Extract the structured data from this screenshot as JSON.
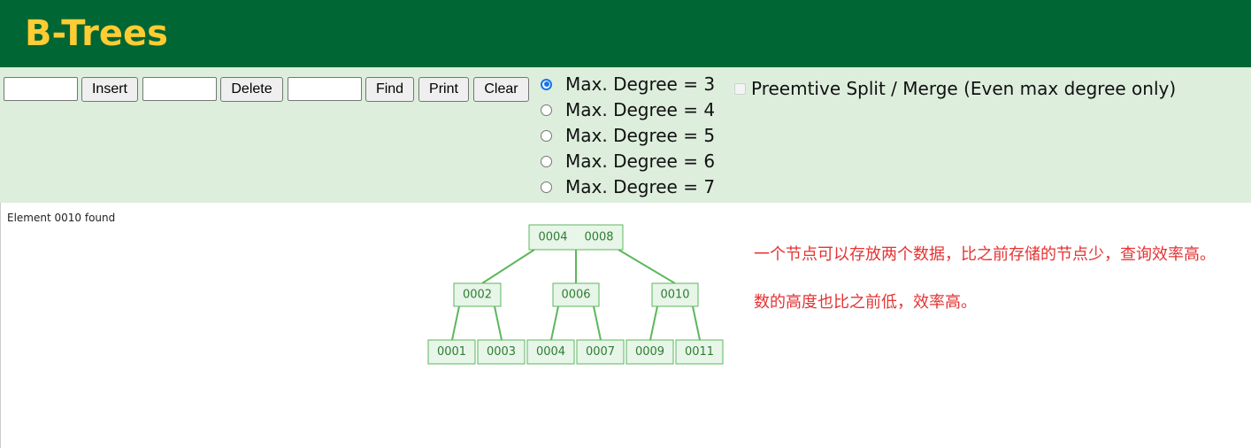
{
  "header": {
    "title": "B-Trees"
  },
  "controls": {
    "insert": {
      "value": "",
      "button": "Insert"
    },
    "delete": {
      "value": "",
      "button": "Delete"
    },
    "find": {
      "value": "",
      "button": "Find"
    },
    "print_button": "Print",
    "clear_button": "Clear",
    "degree_options": [
      {
        "label": "Max. Degree = 3",
        "checked": true
      },
      {
        "label": "Max. Degree = 4",
        "checked": false
      },
      {
        "label": "Max. Degree = 5",
        "checked": false
      },
      {
        "label": "Max. Degree = 6",
        "checked": false
      },
      {
        "label": "Max. Degree = 7",
        "checked": false
      }
    ],
    "preemptive": {
      "label": "Preemtive Split / Merge (Even max degree only)",
      "checked": false
    }
  },
  "status": "Element 0010 found",
  "tree": {
    "node_color": "#5cb85c",
    "node_fill": "#e8f5e9",
    "root": {
      "keys": [
        "0004",
        "0008"
      ]
    },
    "level1": [
      {
        "keys": [
          "0002"
        ]
      },
      {
        "keys": [
          "0006"
        ]
      },
      {
        "keys": [
          "0010"
        ]
      }
    ],
    "leaves": [
      {
        "keys": [
          "0001"
        ]
      },
      {
        "keys": [
          "0003"
        ]
      },
      {
        "keys": [
          "0004"
        ]
      },
      {
        "keys": [
          "0007"
        ]
      },
      {
        "keys": [
          "0009"
        ]
      },
      {
        "keys": [
          "0011"
        ]
      }
    ]
  },
  "notes": [
    "一个节点可以存放两个数据，比之前存储的节点少，查询效率高。",
    "数的高度也比之前低，效率高。"
  ]
}
